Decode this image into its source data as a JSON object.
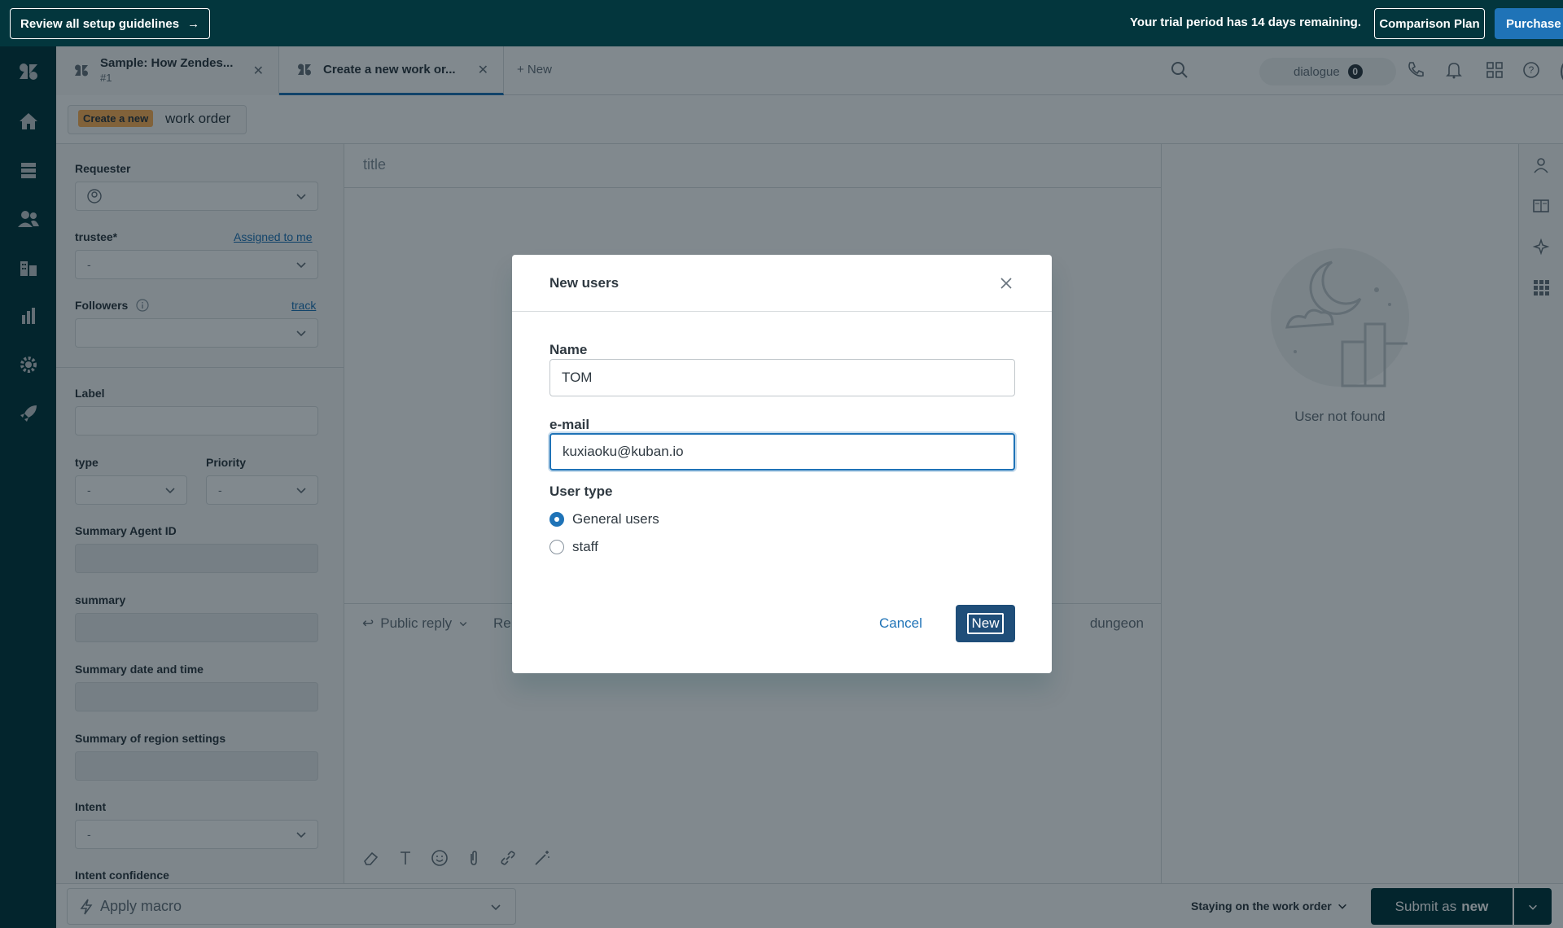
{
  "banner": {
    "review_label": "Review all setup guidelines",
    "trial_text": "Your trial period has 14 days remaining.",
    "compare_label": "Comparison Plan",
    "purchase_label": "Purchase"
  },
  "tabs": [
    {
      "title": "Sample: How Zendes...",
      "subtitle": "#1"
    },
    {
      "title": "Create a new work or..."
    }
  ],
  "new_tab_label": "+ New",
  "topbar": {
    "dialogue_label": "dialogue",
    "dialogue_count": "0"
  },
  "breadcrumb": {
    "badge": "Create a new",
    "text": "work order"
  },
  "properties": {
    "requester_label": "Requester",
    "trustee_label": "trustee*",
    "assigned_link": "Assigned to me",
    "trustee_value": "-",
    "followers_label": "Followers",
    "track_link": "track",
    "label_label": "Label",
    "type_label": "type",
    "type_value": "-",
    "priority_label": "Priority",
    "priority_value": "-",
    "summary_agent_label": "Summary Agent ID",
    "summary_label": "summary",
    "summary_date_label": "Summary date and time",
    "summary_region_label": "Summary of region settings",
    "intent_label": "Intent",
    "intent_value": "-",
    "intent_conf_label": "Intent confidence"
  },
  "editor": {
    "title_placeholder": "title",
    "reply_type": "Public reply",
    "reply_re": "Re",
    "dungeon": "dungeon"
  },
  "userpanel": {
    "not_found": "User not found"
  },
  "bottombar": {
    "macro_label": "Apply macro",
    "staying_label": "Staying on the work order",
    "submit_prefix": "Submit as",
    "submit_status": "new"
  },
  "modal": {
    "title": "New users",
    "name_label": "Name",
    "name_value": "TOM",
    "email_label": "e-mail",
    "email_value": "kuxiaoku@kuban.io",
    "user_type_label": "User type",
    "option_general": "General users",
    "option_staff": "staff",
    "selected_option": "General users",
    "cancel_label": "Cancel",
    "new_label": "New"
  },
  "colors": {
    "brand_dark": "#03363d",
    "accent_blue": "#1f73b7",
    "badge_orange": "#ffb057"
  }
}
